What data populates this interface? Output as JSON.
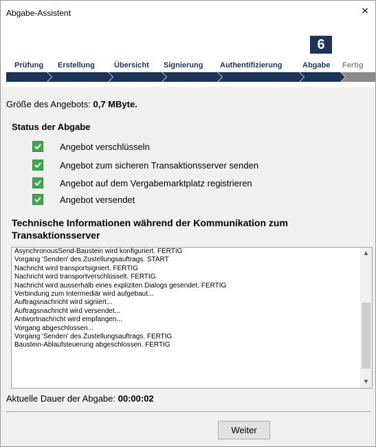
{
  "window": {
    "title": "Abgabe-Assistent",
    "close_label": "×"
  },
  "steps": {
    "current_number": "6",
    "items": [
      {
        "label": "Prüfung"
      },
      {
        "label": "Erstellung"
      },
      {
        "label": "Übersicht"
      },
      {
        "label": "Signierung"
      },
      {
        "label": "Authentifizierung"
      },
      {
        "label": "Abgabe"
      },
      {
        "label": "Fertig"
      }
    ],
    "colors": {
      "active": "#1c3557",
      "inactive": "#8a8a8a"
    }
  },
  "offer_size": {
    "label": "Größe des Angebots:",
    "value": "0,7 MByte."
  },
  "status": {
    "title": "Status der Abgabe",
    "items": [
      {
        "label": "Angebot verschlüsseln"
      },
      {
        "label": "Angebot zum sicheren Transaktionsserver senden"
      },
      {
        "label": "Angebot auf dem Vergabemarktplatz registrieren"
      },
      {
        "label": "Angebot versendet"
      }
    ]
  },
  "technical": {
    "title": "Technische Informationen während der Kommunikation zum Transaktionsserver",
    "log": [
      "AsynchronousSend-Baustein wird konfiguriert. FERTIG",
      "Vorgang 'Senden' des Zustellungsauftrags. START",
      "Nachricht wird transportsigniert. FERTIG",
      "Nachricht wird transportverschlüsselt. FERTIG",
      "Nachricht wird ausserhalb eines expliziten Dialogs gesendet. FERTIG",
      "Verbindung zum Intermediär wird aufgebaut...",
      "Auftragsnachricht wird signiert...",
      "Auftragsnachricht wird versendet...",
      "Antwortnachricht wird empfangen...",
      "Vorgang abgeschlossen...",
      "Vorgang 'Senden' des Zustellungsauftrags. FERTIG",
      "Baustein-Ablaufsteuerung abgeschlossen. FERTIG"
    ]
  },
  "duration": {
    "label": "Aktuelle Dauer der Abgabe:",
    "value": "00:00:02"
  },
  "buttons": {
    "next": "Weiter"
  }
}
